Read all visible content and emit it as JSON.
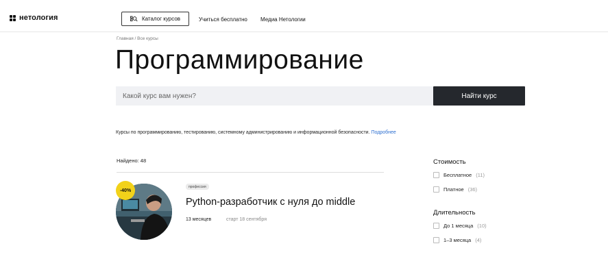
{
  "header": {
    "logo_text": "нетология",
    "catalog_label": "Каталог курсов",
    "nav": [
      "Учиться бесплатно",
      "Медиа Нетологии"
    ]
  },
  "breadcrumb": "Главная / Все курсы",
  "page_title": "Программирование",
  "search": {
    "placeholder": "Какой курс вам нужен?",
    "button_label": "Найти курс"
  },
  "description": {
    "text": "Курсы по программированию, тестированию, системному администрированию и информационной безопасности.",
    "more_link": "Подробнее"
  },
  "found": "Найдено: 48",
  "course": {
    "discount": "-40%",
    "tag": "профессия",
    "title": "Python-разработчик с нуля до middle",
    "duration": "13 месяцев",
    "start": "старт 18 сентября"
  },
  "filters": {
    "cost": {
      "title": "Стоимость",
      "options": [
        {
          "label": "Бесплатное",
          "count": "(11)"
        },
        {
          "label": "Платное",
          "count": "(36)"
        }
      ]
    },
    "duration": {
      "title": "Длительность",
      "options": [
        {
          "label": "До 1 месяца",
          "count": "(10)"
        },
        {
          "label": "1–3 месяца",
          "count": "(4)"
        }
      ]
    }
  },
  "colors": {
    "accent_link": "#2d6fd0",
    "discount_badge": "#f2d21a",
    "search_button": "#25282d"
  }
}
